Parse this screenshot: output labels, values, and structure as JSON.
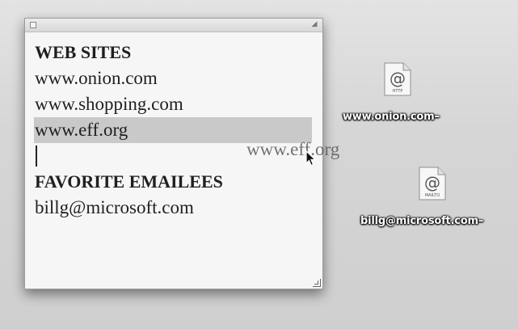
{
  "note": {
    "lines": {
      "web_heading": "WEB SITES",
      "site1": "www.onion.com",
      "site2": "www.shopping.com",
      "site3": "www.eff.org",
      "email_heading": "FAVORITE EMAILEES",
      "email1": "billg@microsoft.com"
    },
    "selected_line": "site3"
  },
  "drag_ghost": "www.eff.org",
  "desktop_icons": {
    "http_clipping": {
      "badge": "HTTP",
      "label": "www.onion.com–"
    },
    "mailto_clipping": {
      "badge": "MAILTO",
      "label": "billg@microsoft.com–"
    }
  },
  "colors": {
    "desktop": "#d6d6d6",
    "note_bg": "#f6f6f6",
    "selection": "#c9c9c9"
  }
}
